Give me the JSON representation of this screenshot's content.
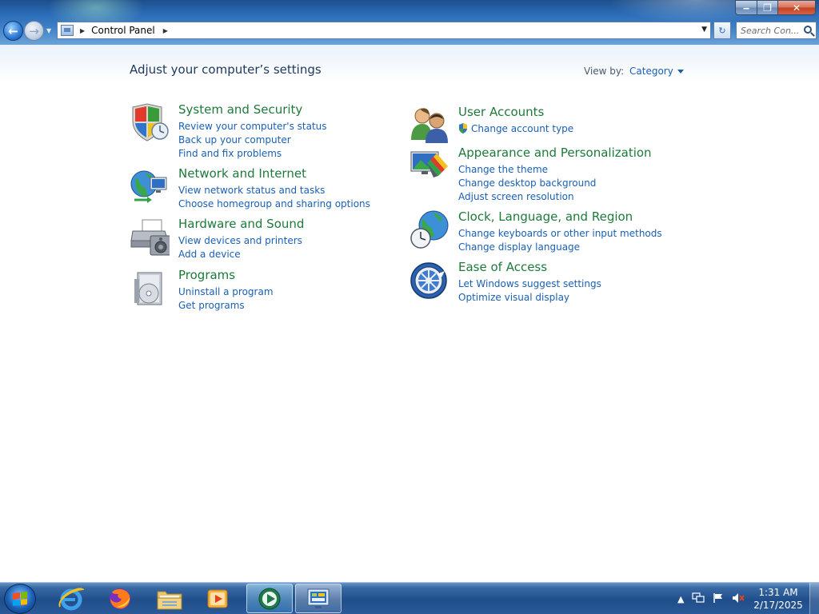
{
  "window": {
    "minimize_label": "‒",
    "maximize_label": "❐",
    "close_label": "✕"
  },
  "address": {
    "location": "Control Panel"
  },
  "search": {
    "placeholder": "Search Con..."
  },
  "page": {
    "title": "Adjust your computer’s settings",
    "view_by_label": "View by:",
    "view_by_value": "Category"
  },
  "categories": {
    "left": [
      {
        "title": "System and Security",
        "icon": "shield-icon",
        "links": [
          "Review your computer's status",
          "Back up your computer",
          "Find and fix problems"
        ]
      },
      {
        "title": "Network and Internet",
        "icon": "network-globe-icon",
        "links": [
          "View network status and tasks",
          "Choose homegroup and sharing options"
        ]
      },
      {
        "title": "Hardware and Sound",
        "icon": "printer-speaker-icon",
        "links": [
          "View devices and printers",
          "Add a device"
        ]
      },
      {
        "title": "Programs",
        "icon": "programs-disc-icon",
        "links": [
          "Uninstall a program",
          "Get programs"
        ]
      }
    ],
    "right": [
      {
        "title": "User Accounts",
        "icon": "users-icon",
        "links": [
          "Change account type"
        ]
      },
      {
        "title": "Appearance and Personalization",
        "icon": "monitor-paint-icon",
        "links": [
          "Change the theme",
          "Change desktop background",
          "Adjust screen resolution"
        ]
      },
      {
        "title": "Clock, Language, and Region",
        "icon": "clock-globe-icon",
        "links": [
          "Change keyboards or other input methods",
          "Change display language"
        ]
      },
      {
        "title": "Ease of Access",
        "icon": "ease-of-access-icon",
        "links": [
          "Let Windows suggest settings",
          "Optimize visual display"
        ]
      }
    ]
  },
  "taskbar": {
    "pinned": [
      "internet-explorer-icon",
      "firefox-icon",
      "file-explorer-icon",
      "media-player-icon",
      "media-center-icon",
      "control-panel-icon"
    ],
    "clock_time": "1:31 AM",
    "clock_date": "2/17/2025"
  },
  "colors": {
    "category_title": "#1d7a3a",
    "link": "#1a5fb4",
    "heading": "#1e395b"
  }
}
